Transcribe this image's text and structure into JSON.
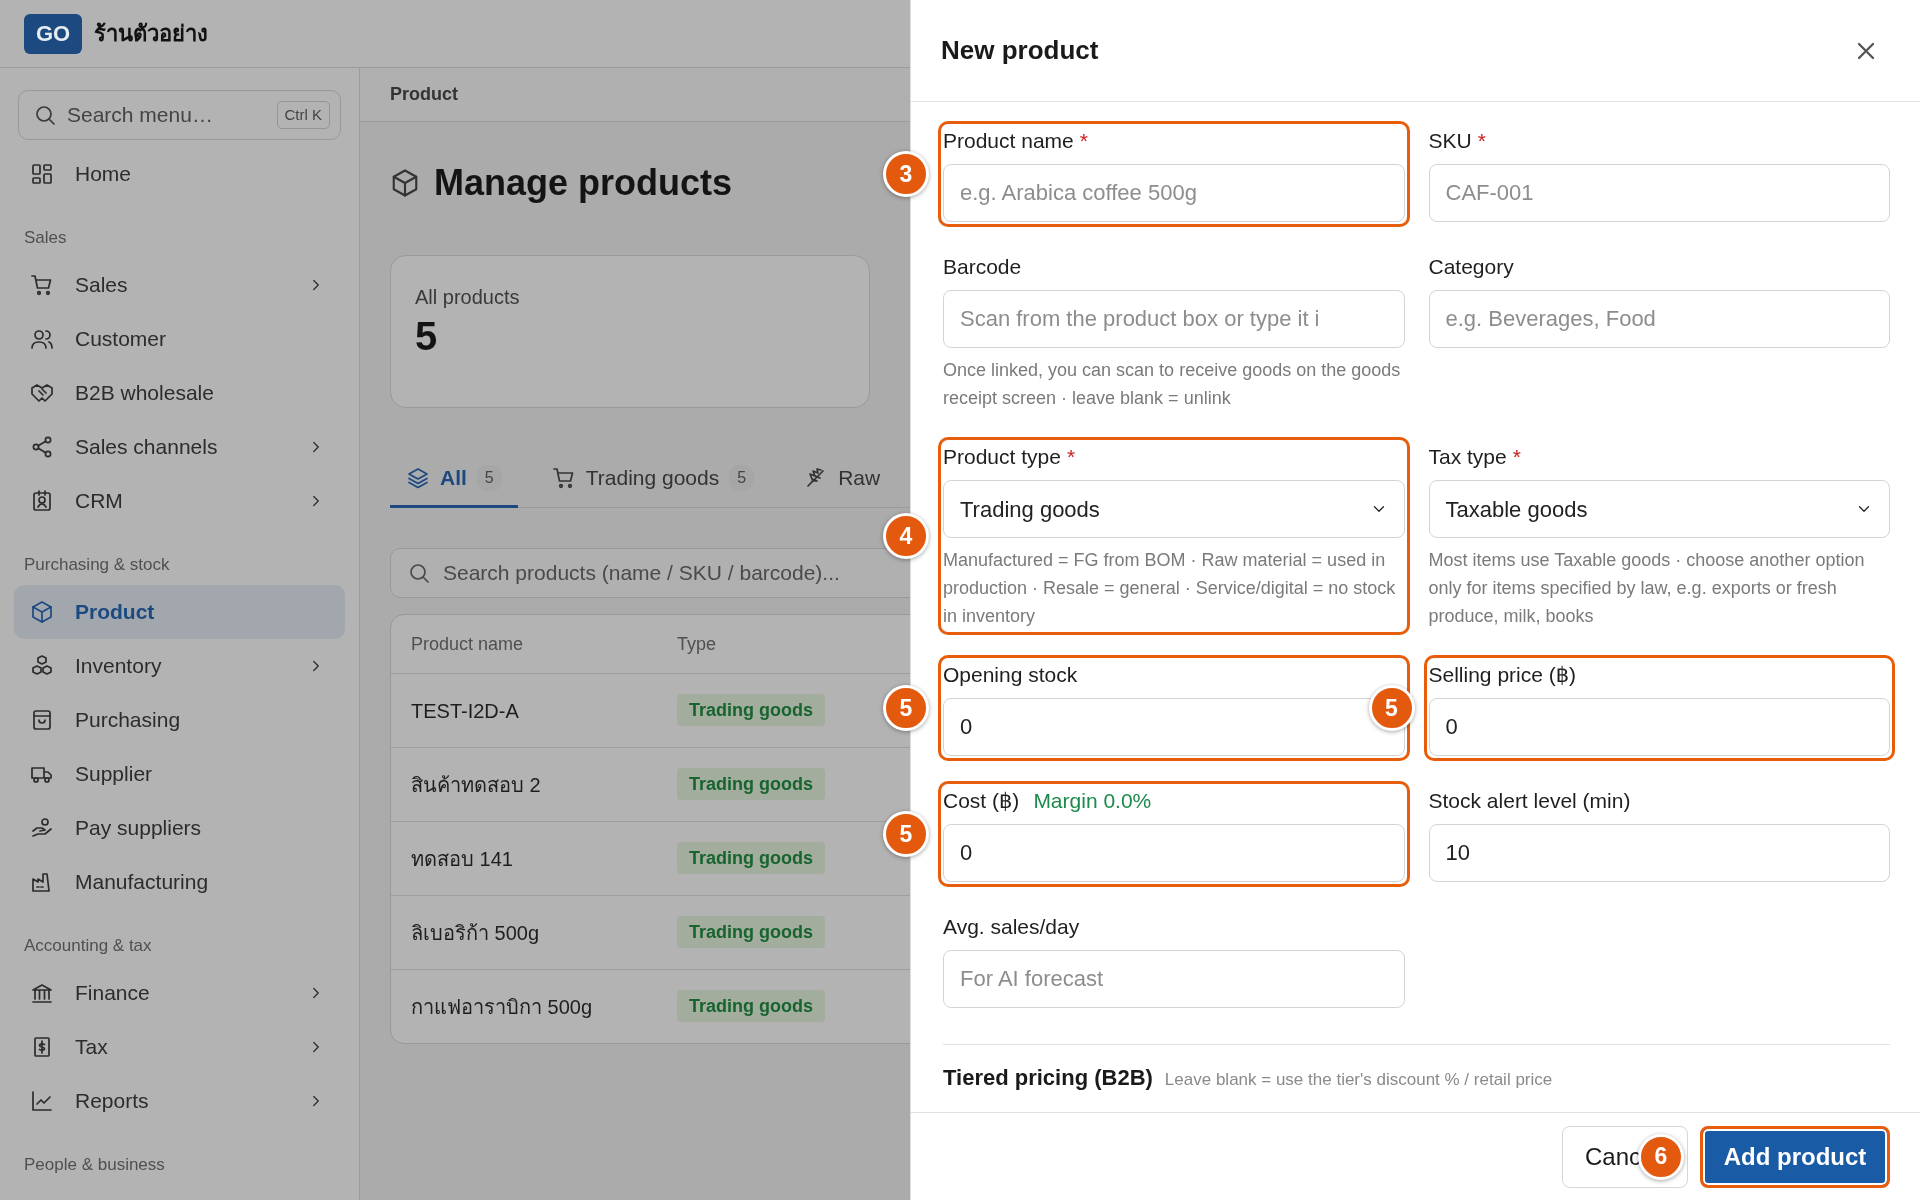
{
  "store": {
    "logo": "GO",
    "name": "ร้านตัวอย่าง"
  },
  "sidebar": {
    "search": {
      "placeholder": "Search menu…",
      "shortcut": "Ctrl K"
    },
    "items": [
      {
        "kind": "link",
        "label": "Home",
        "submenu": false,
        "selected": false
      },
      {
        "kind": "section",
        "label": "Sales"
      },
      {
        "kind": "link",
        "label": "Sales",
        "submenu": true,
        "selected": false
      },
      {
        "kind": "link",
        "label": "Customer",
        "submenu": false,
        "selected": false
      },
      {
        "kind": "link",
        "label": "B2B wholesale",
        "submenu": false,
        "selected": false
      },
      {
        "kind": "link",
        "label": "Sales channels",
        "submenu": true,
        "selected": false
      },
      {
        "kind": "link",
        "label": "CRM",
        "submenu": true,
        "selected": false
      },
      {
        "kind": "section",
        "label": "Purchasing & stock"
      },
      {
        "kind": "link",
        "label": "Product",
        "submenu": false,
        "selected": true
      },
      {
        "kind": "link",
        "label": "Inventory",
        "submenu": true,
        "selected": false
      },
      {
        "kind": "link",
        "label": "Purchasing",
        "submenu": false,
        "selected": false
      },
      {
        "kind": "link",
        "label": "Supplier",
        "submenu": false,
        "selected": false
      },
      {
        "kind": "link",
        "label": "Pay suppliers",
        "submenu": false,
        "selected": false
      },
      {
        "kind": "link",
        "label": "Manufacturing",
        "submenu": false,
        "selected": false
      },
      {
        "kind": "section",
        "label": "Accounting & tax"
      },
      {
        "kind": "link",
        "label": "Finance",
        "submenu": true,
        "selected": false
      },
      {
        "kind": "link",
        "label": "Tax",
        "submenu": true,
        "selected": false
      },
      {
        "kind": "link",
        "label": "Reports",
        "submenu": true,
        "selected": false
      },
      {
        "kind": "section",
        "label": "People & business"
      }
    ]
  },
  "main": {
    "breadcrumb": "Product",
    "title": "Manage products",
    "stats": [
      {
        "label": "All products",
        "value": "5"
      }
    ],
    "tabs": [
      {
        "label": "All",
        "count": "5",
        "selected": true
      },
      {
        "label": "Trading goods",
        "count": "5",
        "selected": false
      },
      {
        "label": "Raw",
        "selected": false
      }
    ],
    "search": {
      "placeholder": "Search products (name / SKU / barcode)..."
    },
    "table": {
      "columns": [
        "Product name",
        "Type"
      ],
      "rows": [
        {
          "name": "TEST-I2D-A",
          "type": "Trading goods"
        },
        {
          "name": "สินค้าทดสอบ 2",
          "type": "Trading goods"
        },
        {
          "name": "ทดสอบ 141",
          "type": "Trading goods"
        },
        {
          "name": "ลิเบอริก้า 500g",
          "type": "Trading goods"
        },
        {
          "name": "กาแฟอาราบิกา 500g",
          "type": "Trading goods"
        }
      ]
    }
  },
  "drawer": {
    "title": "New product",
    "fields": [
      {
        "kind": "text",
        "label": "Product name",
        "required_mark": "*",
        "placeholder": "e.g. Arabica coffee 500g",
        "highlighted": true,
        "callout": "3"
      },
      {
        "kind": "text",
        "label": "SKU",
        "required_mark": "*",
        "placeholder": "CAF-001",
        "highlighted": false
      },
      {
        "kind": "text",
        "label": "Barcode",
        "placeholder": "Scan from the product box or type it i",
        "help": "Once linked, you can scan to receive goods on the goods receipt screen · leave blank = unlink",
        "highlighted": false
      },
      {
        "kind": "text",
        "label": "Category",
        "placeholder": "e.g. Beverages, Food",
        "highlighted": false
      },
      {
        "kind": "select",
        "label": "Product type",
        "required_mark": "*",
        "value": "Trading goods",
        "help": "Manufactured = FG from BOM · Raw material = used in production · Resale = general · Service/digital = no stock in inventory",
        "highlighted": true,
        "callout": "4"
      },
      {
        "kind": "select",
        "label": "Tax type",
        "required_mark": "*",
        "value": "Taxable goods",
        "help": "Most items use Taxable goods · choose another option only for items specified by law, e.g. exports or fresh produce, milk, books",
        "highlighted": false
      },
      {
        "kind": "text",
        "label": "Opening stock",
        "value": "0",
        "highlighted": true,
        "callout": "5"
      },
      {
        "kind": "text",
        "label": "Selling price (฿)",
        "value": "0",
        "highlighted": true,
        "callout": "5"
      },
      {
        "kind": "text",
        "label": "Cost (฿)",
        "note": "Margin 0.0%",
        "value": "0",
        "highlighted": true,
        "callout": "5"
      },
      {
        "kind": "text",
        "label": "Stock alert level (min)",
        "value": "10",
        "highlighted": false
      },
      {
        "kind": "text",
        "label": "Avg. sales/day",
        "placeholder": "For AI forecast",
        "highlighted": false
      }
    ],
    "section": {
      "title": "Tiered pricing (B2B)",
      "hint": "Leave blank = use the tier's discount % / retail price"
    },
    "buttons": [
      {
        "kind": "secondary",
        "label": "Canc",
        "highlighted": false
      },
      {
        "kind": "primary",
        "label": "Add product",
        "highlighted": true,
        "callout": "6"
      }
    ]
  }
}
